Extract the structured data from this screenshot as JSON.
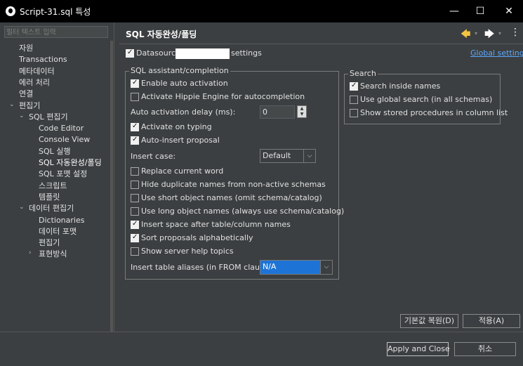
{
  "window": {
    "title": "Script-31.sql 특성",
    "minimize": "—",
    "maximize": "☐",
    "close": "✕"
  },
  "filter": {
    "placeholder": "필터 텍스트 입력"
  },
  "tree": [
    {
      "label": "자원",
      "indent": 0
    },
    {
      "label": "Transactions",
      "indent": 0
    },
    {
      "label": "메타데이터",
      "indent": 0
    },
    {
      "label": "에러 처리",
      "indent": 0
    },
    {
      "label": "연결",
      "indent": 0
    },
    {
      "label": "편집기",
      "indent": 0
    },
    {
      "label": "SQL 편집기",
      "indent": 1
    },
    {
      "label": "Code Editor",
      "indent": 2
    },
    {
      "label": "Console View",
      "indent": 2
    },
    {
      "label": "SQL 실행",
      "indent": 2
    },
    {
      "label": "SQL 자동완성/폴딩",
      "indent": 2
    },
    {
      "label": "SQL 포맷 설정",
      "indent": 2
    },
    {
      "label": "스크립트",
      "indent": 2
    },
    {
      "label": "템플릿",
      "indent": 2
    },
    {
      "label": "데이터 편집기",
      "indent": 1
    },
    {
      "label": "Dictionaries",
      "indent": 2
    },
    {
      "label": "데이터 포맷",
      "indent": 2
    },
    {
      "label": "편집기",
      "indent": 2
    },
    {
      "label": "표현방식",
      "indent": 2
    }
  ],
  "page": {
    "title": "SQL 자동완성/폴딩"
  },
  "datasource": {
    "prefix": "Datasource",
    "suffix": "settings",
    "global_link": "Global settings",
    "checked": true
  },
  "assist": {
    "legend": "SQL assistant/completion",
    "enable_auto": "Enable auto activation",
    "hippie": "Activate Hippie Engine for autocompletion",
    "delay_label": "Auto activation delay (ms):",
    "delay_value": "0",
    "typing": "Activate on typing",
    "auto_insert": "Auto-insert proposal",
    "insert_case_label": "Insert case:",
    "insert_case_value": "Default",
    "replace_word": "Replace current word",
    "hide_dup": "Hide duplicate names from non-active schemas",
    "short_names": "Use short object names (omit schema/catalog)",
    "long_names": "Use long object names (always use schema/catalog)",
    "insert_space": "Insert space after table/column names",
    "sort_alpha": "Sort proposals alphabetically",
    "server_help": "Show server help topics",
    "aliases_label": "Insert table aliases (in FROM clause):",
    "aliases_value": "N/A"
  },
  "search": {
    "legend": "Search",
    "inside_names": "Search inside names",
    "global_search": "Use global search (in all schemas)",
    "stored_procs": "Show stored procedures in column list"
  },
  "buttons": {
    "restore": "기본값 복원(D)",
    "apply": "적용(A)",
    "apply_close": "Apply and Close",
    "cancel": "취소"
  }
}
